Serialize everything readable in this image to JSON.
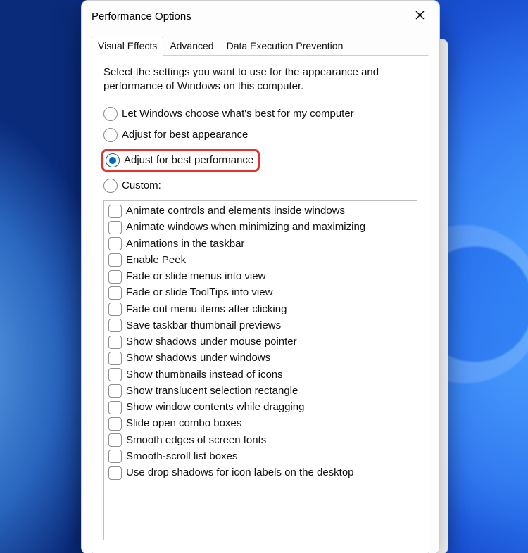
{
  "window": {
    "title": "Performance Options"
  },
  "tabs": {
    "visual_effects": "Visual Effects",
    "advanced": "Advanced",
    "dep": "Data Execution Prevention"
  },
  "description": "Select the settings you want to use for the appearance and performance of Windows on this computer.",
  "radios": {
    "let_windows": {
      "label": "Let Windows choose what's best for my computer",
      "selected": false
    },
    "best_appearance": {
      "label": "Adjust for best appearance",
      "selected": false
    },
    "best_performance": {
      "label": "Adjust for best performance",
      "selected": true
    },
    "custom": {
      "label": "Custom:",
      "selected": false
    }
  },
  "effects": [
    "Animate controls and elements inside windows",
    "Animate windows when minimizing and maximizing",
    "Animations in the taskbar",
    "Enable Peek",
    "Fade or slide menus into view",
    "Fade or slide ToolTips into view",
    "Fade out menu items after clicking",
    "Save taskbar thumbnail previews",
    "Show shadows under mouse pointer",
    "Show shadows under windows",
    "Show thumbnails instead of icons",
    "Show translucent selection rectangle",
    "Show window contents while dragging",
    "Slide open combo boxes",
    "Smooth edges of screen fonts",
    "Smooth-scroll list boxes",
    "Use drop shadows for icon labels on the desktop"
  ]
}
